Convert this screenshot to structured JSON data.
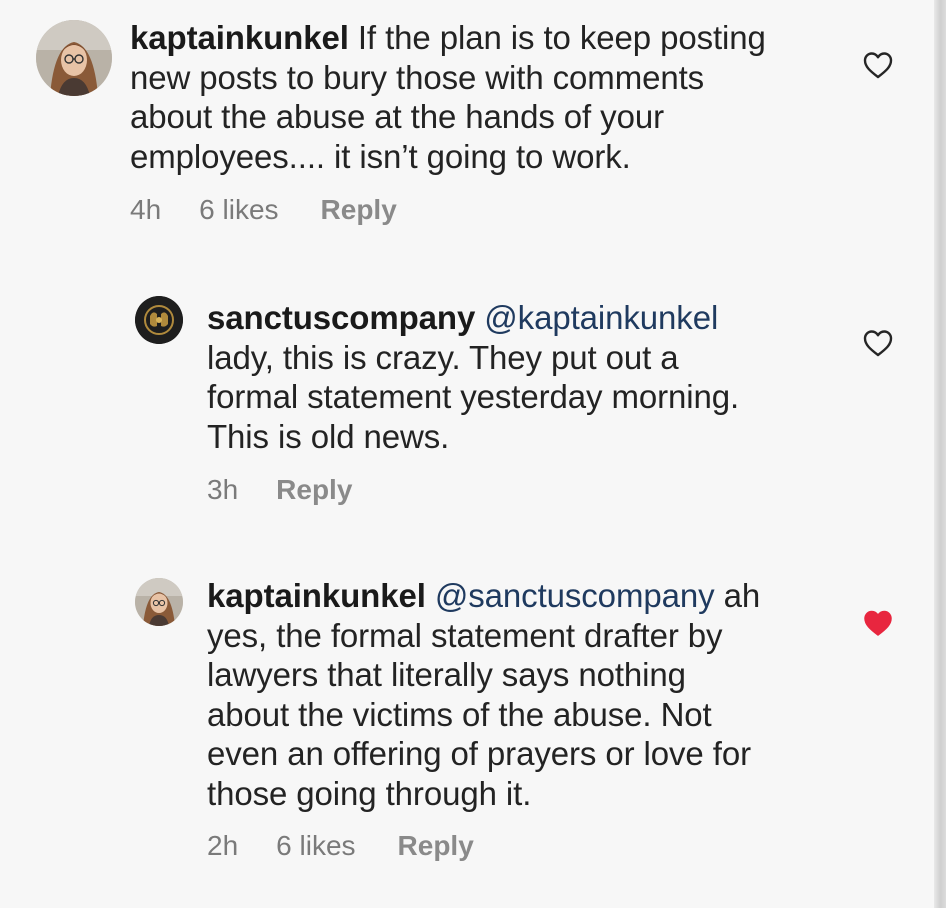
{
  "comments": [
    {
      "username": "kaptainkunkel",
      "mention": "",
      "text": "If the plan is to keep posting new posts to bury those with comments about the abuse at the hands of your employees.... it isn't going to work.",
      "lines": [
        "If the plan is to keep posting",
        "new posts to bury those with comments",
        "about the abuse at the hands of your",
        "employees.... it isn’t going to work."
      ],
      "time": "4h",
      "likes": "6 likes",
      "reply_label": "Reply",
      "liked": false,
      "avatar_icon": "profile-photo-woman-with-glasses"
    },
    {
      "username": "sanctuscompany",
      "mention": "@kaptainkunkel",
      "text": "lady, this is crazy. They put out a formal statement yesterday morning. This is old news.",
      "lines": [
        "lady, this is crazy. They put out a",
        "formal statement yesterday morning.",
        "This is old news."
      ],
      "time": "3h",
      "likes": "",
      "reply_label": "Reply",
      "liked": false,
      "avatar_icon": "company-logo-hands"
    },
    {
      "username": "kaptainkunkel",
      "mention": "@sanctuscompany",
      "text": "ah yes, the formal statement drafter by lawyers that literally says nothing about the victims of the abuse. Not even an offering of prayers or love for those going through it.",
      "lines": [
        " ah",
        "yes, the formal statement drafter by",
        "lawyers that literally says nothing",
        "about the victims of the abuse. Not",
        "even an offering of prayers or love for",
        "those going through it."
      ],
      "time": "2h",
      "likes": "6 likes",
      "reply_label": "Reply",
      "liked": true,
      "avatar_icon": "profile-photo-woman-with-glasses"
    }
  ],
  "colors": {
    "liked_heart": "#e8263f",
    "text": "#232323",
    "meta": "#7a7a7a"
  }
}
